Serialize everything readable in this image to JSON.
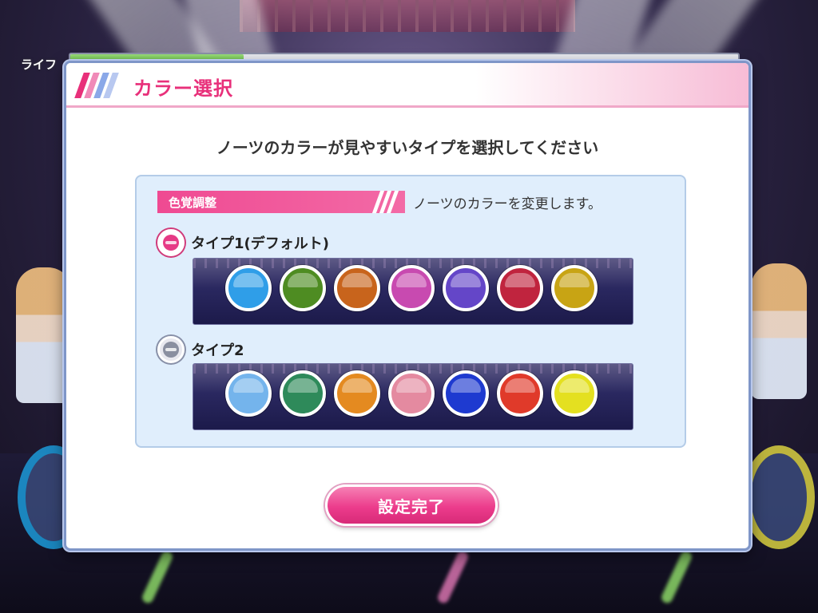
{
  "hud": {
    "life_label": "ライフ",
    "life_fraction": 0.26
  },
  "modal": {
    "title": "カラー選択",
    "instruction": "ノーツのカラーが見やすいタイプを選択してください",
    "section": {
      "tag": "色覚調整",
      "description": "ノーツのカラーを変更します。"
    },
    "options": [
      {
        "label": "タイプ1(デフォルト)",
        "selected": true,
        "colors": [
          "#2f9ee8",
          "#4e8c22",
          "#c8641c",
          "#c84ab0",
          "#6446c8",
          "#c0243e",
          "#c8a414"
        ]
      },
      {
        "label": "タイプ2",
        "selected": false,
        "colors": [
          "#74b4ec",
          "#2e8a5a",
          "#e48a20",
          "#e48aa0",
          "#1e3ad0",
          "#e03a2a",
          "#e4e020"
        ]
      }
    ],
    "confirm_label": "設定完了"
  },
  "colors": {
    "accent": "#e8307a",
    "panel_bg": "#e0eefc"
  }
}
